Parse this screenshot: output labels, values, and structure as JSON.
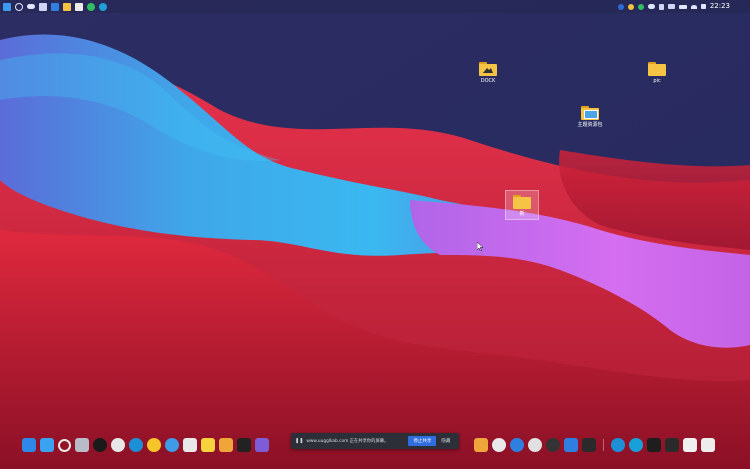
{
  "topbar": {
    "clock": "22:23"
  },
  "desktop_icons": [
    {
      "label": "DOCK",
      "kind": "folder-image"
    },
    {
      "label": "pic",
      "kind": "folder"
    },
    {
      "label": "主题资源包",
      "kind": "folder-picture"
    },
    {
      "label": "新",
      "kind": "folder",
      "selected": true
    }
  ],
  "share_bar": {
    "text": "www.uugglkab.com 正在共享你的屏幕。",
    "stop_label": "停止共享",
    "hide_label": "隐藏"
  },
  "taskbar": {
    "icons": [
      "windows-start-icon",
      "desktop-icon",
      "search-icon",
      "recycle-bin-icon",
      "qq-icon",
      "wechat-icon",
      "edge-icon",
      "browser-icon",
      "globe-icon",
      "photos-icon",
      "app-a-icon",
      "app-a2-icon",
      "inkscape-icon",
      "chat-icon",
      "calendar-icon",
      "gamepad-icon",
      "safari-icon",
      "headset-icon",
      "app-dark-icon",
      "vscode-icon",
      "app-x-icon",
      "edge-icon-2",
      "edge-dev-icon",
      "terminal-icon",
      "media-icon",
      "notepad-icon",
      "word-icon"
    ]
  }
}
